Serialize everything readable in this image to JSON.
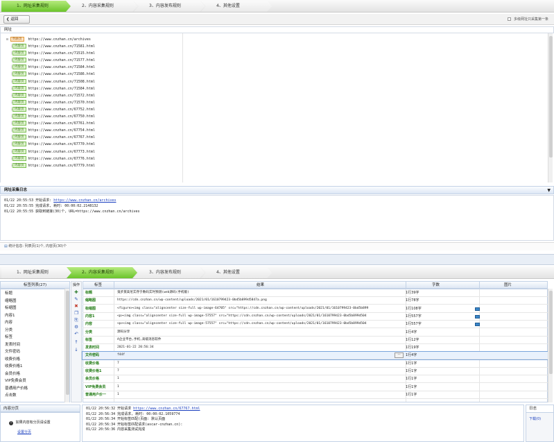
{
  "top": {
    "steps": [
      "1、网址采集规则",
      "2、内容采集规则",
      "3、内容发布规则",
      "4、其他设置"
    ],
    "back_label": "返回",
    "multi_level_label": "多级网址只采集第一条",
    "urls_header": "网址",
    "root_tag": "列表页",
    "content_tag": "内容页",
    "root_url": "https://www.cnzhan.cn/archives",
    "urls": [
      "https://www.cnzhan.cn/71581.html",
      "https://www.cnzhan.cn/71515.html",
      "https://www.cnzhan.cn/71577.html",
      "https://www.cnzhan.cn/71584.html",
      "https://www.cnzhan.cn/71586.html",
      "https://www.cnzhan.cn/71508.html",
      "https://www.cnzhan.cn/71584.html",
      "https://www.cnzhan.cn/71572.html",
      "https://www.cnzhan.cn/71570.html",
      "https://www.cnzhan.cn/67752.html",
      "https://www.cnzhan.cn/67750.html",
      "https://www.cnzhan.cn/67761.html",
      "https://www.cnzhan.cn/67754.html",
      "https://www.cnzhan.cn/67767.html",
      "https://www.cnzhan.cn/67770.html",
      "https://www.cnzhan.cn/67773.html",
      "https://www.cnzhan.cn/67776.html",
      "https://www.cnzhan.cn/67779.html"
    ],
    "log_header": "网址采集日志",
    "log": [
      {
        "text": "01/22 20:55:53 开始请求: ",
        "link": "https://www.cnzhan.cn/archives"
      },
      {
        "text": "01/22 20:55:55 完成请求, 耗时: 00:00:02.2148132",
        "link": ""
      },
      {
        "text": "01/22 20:55:55 获取到链接(30)个, URL=https://www.cnzhan.cn/archives",
        "link": ""
      }
    ],
    "stats": "统计信息: 列表页(1)个, 内容页(30)个"
  },
  "bottom": {
    "steps": [
      "1、网址采集规则",
      "2、内容采集规则",
      "3、内容发布规则",
      "4、其他设置"
    ],
    "label_list_title": "标签列表(27)",
    "tool_title": "操作",
    "labels": [
      "标题",
      "缩略图",
      "标缩图",
      "内容1",
      "内容",
      "分类",
      "标签",
      "发表时间",
      "文件密码",
      "收费价格",
      "收费价格1",
      "会员价格",
      "VIP免费会员",
      "普通用户价格",
      "点击数"
    ],
    "col_label": "标签",
    "col_result": "结果",
    "col_chars": "字数",
    "col_images": "图片",
    "rows": [
      {
        "label": "标题",
        "value": "鬼步莫高尼实存于数码实时预测(web源码(手机版)",
        "chars": "1行39字",
        "img": false
      },
      {
        "label": "缩略图",
        "value": "https://cdn.cnzhan.cn/wp-content/uploads/2021/01/1610799423-0bd5b899d5847a.png",
        "chars": "1行78字",
        "img": false
      },
      {
        "label": "标缩图",
        "value": "<figure><img class=\"aligncenter size-full wp-image-64705\" src=\"https://cdn.cnzhan.cn/wp-content/uploads/2021/01/1610799423-0bd5b899",
        "chars": "1行108字",
        "img": true
      },
      {
        "label": "内容1",
        "value": "<p><img class=\"aligncenter size-full wp-image-57557\" src=\"https://cdn.cnzhan.cn/wp-content/uploads/2021/01/1610799423-0bd5b899d504",
        "chars": "1行557字",
        "img": true
      },
      {
        "label": "内容",
        "value": "<p><img class=\"aligncenter size-full wp-image-57557\" src=\"https://cdn.cnzhan.cn/wp-content/uploads/2021/01/1610799423-0bd5b899d504",
        "chars": "1行557字",
        "img": true
      },
      {
        "label": "分类",
        "value": "源码分享",
        "chars": "1行4字",
        "img": false
      },
      {
        "label": "标签",
        "value": "A企业平台,手机,高级消息软件",
        "chars": "1行12字",
        "img": false
      },
      {
        "label": "发表时间",
        "value": "2021-01-22 20:56:34",
        "chars": "1行19字",
        "img": false
      },
      {
        "label": "文件密码",
        "value": "f44f",
        "chars": "1行4字",
        "img": false
      },
      {
        "label": "收费价格",
        "value": "7",
        "chars": "1行1字",
        "img": false
      },
      {
        "label": "收费价格1",
        "value": "7",
        "chars": "1行1字",
        "img": false
      },
      {
        "label": "会员价格",
        "value": "1",
        "chars": "1行1字",
        "img": false
      },
      {
        "label": "VIP免费会员",
        "value": "1",
        "chars": "1行1字",
        "img": false
      },
      {
        "label": "普通用户价一",
        "value": "1",
        "chars": "1行1字",
        "img": false
      }
    ],
    "pagination_title": "内容分页",
    "pagination_info": "如果内容有分页请设置",
    "pagination_link": "设置分页",
    "log": [
      {
        "text": "01/22 20:56:32 开始请求 ",
        "link": "https://www.cnzhan.cn/67767.html"
      },
      {
        "text": "01/22 20:56:34 完成请求, 耗时: 00:00:02.1059774",
        "link": ""
      },
      {
        "text": "01/22 20:56:34 开始标签匹配(页面: 默认页面",
        "link": ""
      },
      {
        "text": "01/22 20:56:34 开始标签匹配请求(ascar-cnzhan.cn):",
        "link": ""
      },
      {
        "text": "01/22 20:56:36 内容采集测试完成",
        "link": ""
      }
    ],
    "right_tab": "日志",
    "right_tab2": "下载(0)"
  },
  "colors": {
    "accent_green": "#6bc42b",
    "label_green": "#1f7a12",
    "link_blue": "#1a3fbf"
  }
}
